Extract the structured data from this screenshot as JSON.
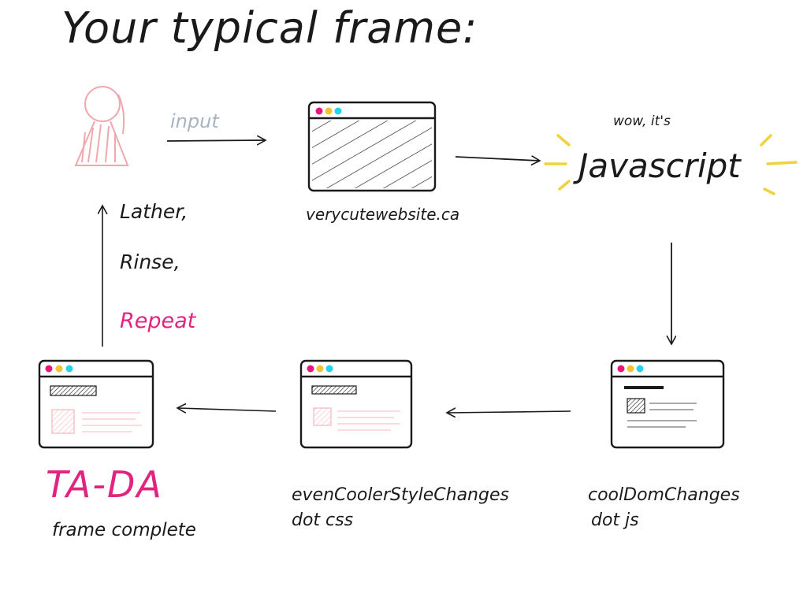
{
  "title": "Your typical frame:",
  "input_label": "input",
  "javascript": {
    "prefix": "wow, it's",
    "word": "Javascript"
  },
  "site_label": "verycutewebsite.ca",
  "loop": {
    "lather": "Lather,",
    "rinse": "Rinse,",
    "repeat": "Repeat"
  },
  "steps": {
    "dom": {
      "name": "coolDomChanges",
      "sub": "dot js"
    },
    "css": {
      "name": "evenCoolerStyleChanges",
      "sub": "dot css"
    },
    "done": {
      "title": "TA-DA",
      "sub": "frame complete"
    }
  },
  "colors": {
    "ink": "#1a1a1a",
    "pink": "#e0247f",
    "person": "#f0a8ae",
    "input": "#a8b3c2",
    "sparkle": "#f0d23c",
    "dot_pink": "#e8157d",
    "dot_yellow": "#f2c230",
    "dot_cyan": "#22d4e8",
    "css_box": "#f4b8bd"
  },
  "icons": [
    "person-icon",
    "browser-window-icon",
    "sparkle-icon",
    "arrow-icon"
  ]
}
